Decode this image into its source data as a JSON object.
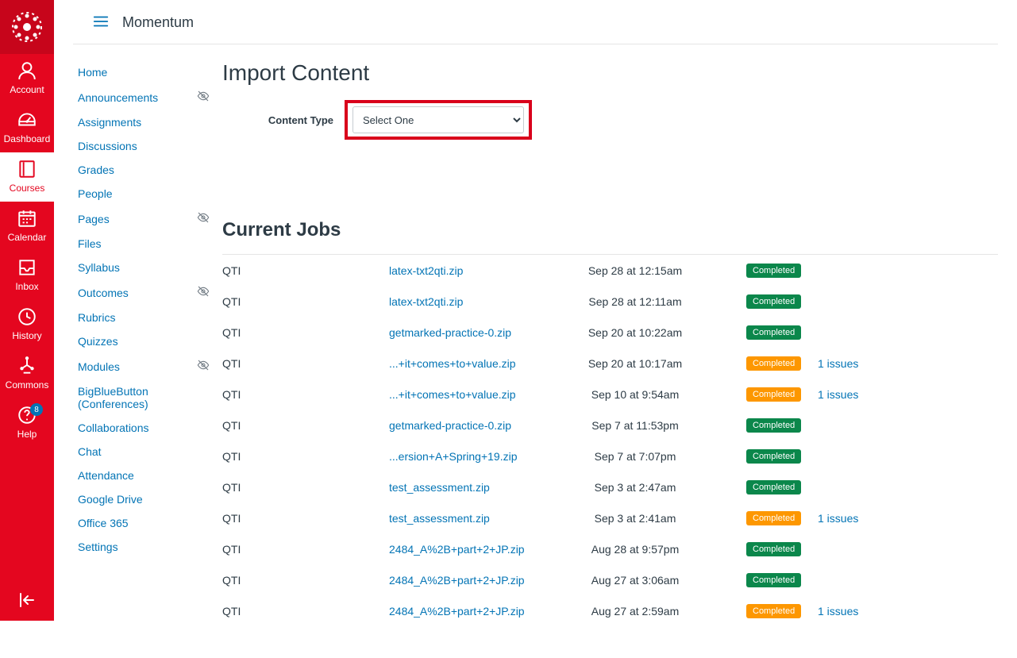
{
  "breadcrumb": "Momentum",
  "global_nav": {
    "items": [
      {
        "label": "Account",
        "icon": "account"
      },
      {
        "label": "Dashboard",
        "icon": "dashboard"
      },
      {
        "label": "Courses",
        "icon": "courses",
        "active": true
      },
      {
        "label": "Calendar",
        "icon": "calendar"
      },
      {
        "label": "Inbox",
        "icon": "inbox"
      },
      {
        "label": "History",
        "icon": "history"
      },
      {
        "label": "Commons",
        "icon": "commons"
      },
      {
        "label": "Help",
        "icon": "help",
        "badge": "8"
      }
    ]
  },
  "course_nav": [
    {
      "label": "Home"
    },
    {
      "label": "Announcements",
      "hidden": true
    },
    {
      "label": "Assignments"
    },
    {
      "label": "Discussions"
    },
    {
      "label": "Grades"
    },
    {
      "label": "People"
    },
    {
      "label": "Pages",
      "hidden": true
    },
    {
      "label": "Files"
    },
    {
      "label": "Syllabus"
    },
    {
      "label": "Outcomes",
      "hidden": true
    },
    {
      "label": "Rubrics"
    },
    {
      "label": "Quizzes"
    },
    {
      "label": "Modules",
      "hidden": true
    },
    {
      "label": "BigBlueButton (Conferences)"
    },
    {
      "label": "Collaborations"
    },
    {
      "label": "Chat"
    },
    {
      "label": "Attendance"
    },
    {
      "label": "Google Drive"
    },
    {
      "label": "Office 365"
    },
    {
      "label": "Settings"
    }
  ],
  "page_title": "Import Content",
  "form": {
    "content_type_label": "Content Type",
    "content_type_value": "Select One"
  },
  "jobs_title": "Current Jobs",
  "jobs": [
    {
      "type": "QTI",
      "file": "latex-txt2qti.zip",
      "date": "Sep 28 at 12:15am",
      "status": "Completed",
      "status_color": "green"
    },
    {
      "type": "QTI",
      "file": "latex-txt2qti.zip",
      "date": "Sep 28 at 12:11am",
      "status": "Completed",
      "status_color": "green"
    },
    {
      "type": "QTI",
      "file": "getmarked-practice-0.zip",
      "date": "Sep 20 at 10:22am",
      "status": "Completed",
      "status_color": "green"
    },
    {
      "type": "QTI",
      "file": "...+it+comes+to+value.zip",
      "date": "Sep 20 at 10:17am",
      "status": "Completed",
      "status_color": "orange",
      "issues": "1 issues"
    },
    {
      "type": "QTI",
      "file": "...+it+comes+to+value.zip",
      "date": "Sep 10 at 9:54am",
      "status": "Completed",
      "status_color": "orange",
      "issues": "1 issues"
    },
    {
      "type": "QTI",
      "file": "getmarked-practice-0.zip",
      "date": "Sep 7 at 11:53pm",
      "status": "Completed",
      "status_color": "green"
    },
    {
      "type": "QTI",
      "file": "...ersion+A+Spring+19.zip",
      "date": "Sep 7 at 7:07pm",
      "status": "Completed",
      "status_color": "green"
    },
    {
      "type": "QTI",
      "file": "test_assessment.zip",
      "date": "Sep 3 at 2:47am",
      "status": "Completed",
      "status_color": "green"
    },
    {
      "type": "QTI",
      "file": "test_assessment.zip",
      "date": "Sep 3 at 2:41am",
      "status": "Completed",
      "status_color": "orange",
      "issues": "1 issues"
    },
    {
      "type": "QTI",
      "file": "2484_A%2B+part+2+JP.zip",
      "date": "Aug 28 at 9:57pm",
      "status": "Completed",
      "status_color": "green"
    },
    {
      "type": "QTI",
      "file": "2484_A%2B+part+2+JP.zip",
      "date": "Aug 27 at 3:06am",
      "status": "Completed",
      "status_color": "green"
    },
    {
      "type": "QTI",
      "file": "2484_A%2B+part+2+JP.zip",
      "date": "Aug 27 at 2:59am",
      "status": "Completed",
      "status_color": "orange",
      "issues": "1 issues"
    }
  ]
}
